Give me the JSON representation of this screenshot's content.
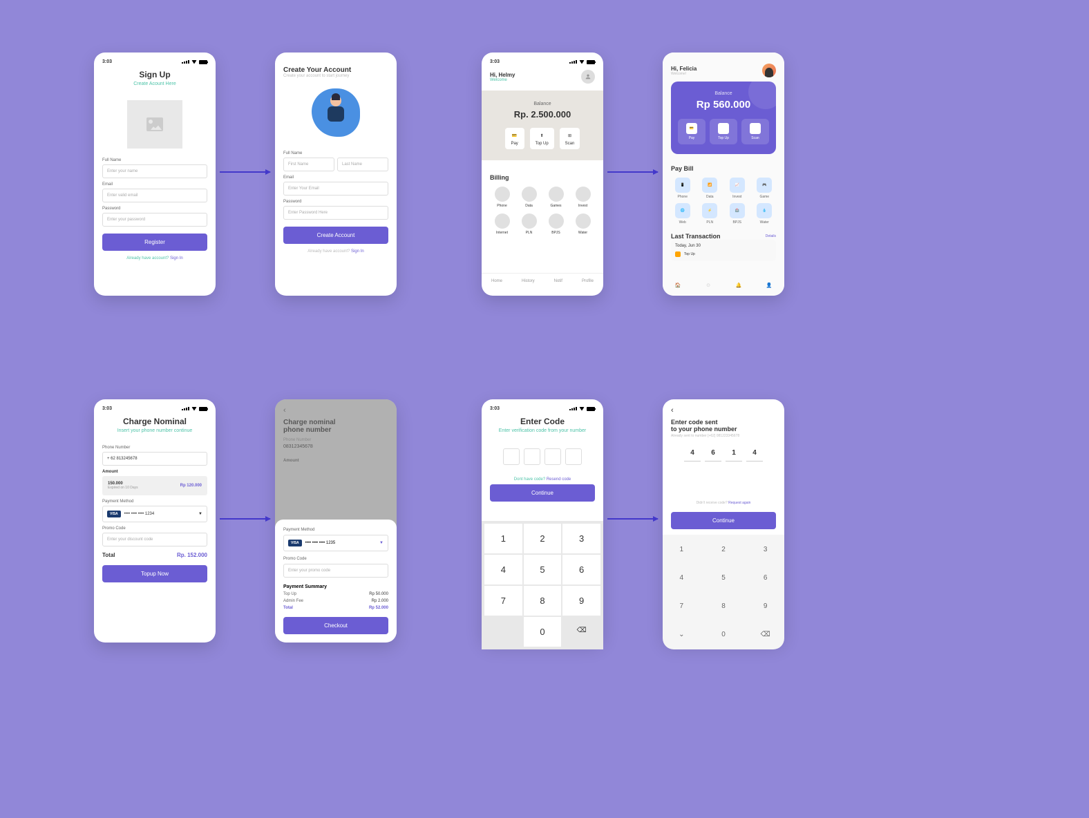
{
  "status_time": "3:03",
  "screens": {
    "signup": {
      "title": "Sign Up",
      "subtitle": "Create Acount Here",
      "full_name_label": "Full Name",
      "full_name_ph": "Enter your name",
      "email_label": "Email",
      "email_ph": "Enter valid email",
      "password_label": "Password",
      "password_ph": "Enter your password",
      "btn": "Register",
      "footer_q": "Already have account? ",
      "footer_link": "Sign In"
    },
    "create": {
      "title": "Create Your Account",
      "subtitle": "Create your account to start journey",
      "full_name_label": "Full Name",
      "first_name_ph": "First Name",
      "last_name_ph": "Last Name",
      "email_label": "Email",
      "email_ph": "Enter Your Email",
      "password_label": "Password",
      "password_ph": "Enter Password Here",
      "btn": "Create Account",
      "footer_q": "Already have account? ",
      "footer_link": "Sign In"
    },
    "home1": {
      "greeting": "Hi, Helmy",
      "welcome": "Welcome",
      "balance_label": "Balance",
      "balance": "Rp. 2.500.000",
      "actions": [
        "Pay",
        "Top Up",
        "Scan"
      ],
      "billing_title": "Billing",
      "billing1": [
        "Phone",
        "Data",
        "Games",
        "Invest"
      ],
      "billing2": [
        "Internet",
        "PLN",
        "BPJS",
        "Water"
      ],
      "nav": [
        "Home",
        "History",
        "Notif",
        "Profile"
      ]
    },
    "home2": {
      "greeting": "Hi, Felicia",
      "welcome": "Welcome!",
      "balance_label": "Balance",
      "balance": "Rp 560.000",
      "actions": [
        "Pay",
        "Top Up",
        "Scan"
      ],
      "paybill_title": "Pay Bill",
      "row1": [
        "Phone",
        "Data",
        "Invest",
        "Game"
      ],
      "row2": [
        "Web",
        "PLN",
        "BPJS",
        "Water"
      ],
      "last_trans": "Last Transaction",
      "details": "Details",
      "trans_date": "Today, Jun 30",
      "trans_item": "Top Up"
    },
    "charge": {
      "title": "Charge Nominal",
      "subtitle": "Insert your phone number continue",
      "phone_label": "Phone Number",
      "phone": "+ 62 813245678",
      "amount_label": "Amount",
      "amount_main": "150.000",
      "amount_sub": "Expired on 10 Days",
      "amount_price": "Rp 120.000",
      "payment_label": "Payment Method",
      "card_dots": "•••• •••• •••• 1234",
      "promo_label": "Promo Code",
      "promo_ph": "Enter your discount code",
      "total_label": "Total",
      "total": "Rp. 152.000",
      "btn": "Topup Now"
    },
    "checkout": {
      "bg_title": "Charge nominal\nphone number",
      "bg_phone_label": "Phone Number",
      "bg_phone": "08312345678",
      "bg_amount": "Amount",
      "payment_label": "Payment Method",
      "card_dots": "•••• •••• •••• 1235",
      "promo_label": "Promo Code",
      "promo_ph": "Enter your promo code",
      "summary_title": "Payment Summary",
      "rows": [
        {
          "l": "Top Up",
          "v": "Rp 50.000"
        },
        {
          "l": "Admin Fee",
          "v": "Rp 2.000"
        },
        {
          "l": "Total",
          "v": "Rp 52.000"
        }
      ],
      "btn": "Checkout"
    },
    "code1": {
      "title": "Enter Code",
      "subtitle": "Enter verification code from your number",
      "resend_q": "Dont have code? ",
      "resend_link": "Resend code",
      "btn": "Continue",
      "keys": [
        "1",
        "2",
        "3",
        "4",
        "5",
        "6",
        "7",
        "8",
        "9",
        "",
        "0",
        "⌫"
      ]
    },
    "code2": {
      "title1": "Enter code sent",
      "title2": "to your phone number",
      "sent_to": "Already sent to number [+62] 081223345678",
      "digits": [
        "4",
        "6",
        "1",
        "4"
      ],
      "resend_q": "Didn't receive code? ",
      "resend_link": "Request again",
      "btn": "Continue",
      "keys": [
        "1",
        "2",
        "3",
        "4",
        "5",
        "6",
        "7",
        "8",
        "9",
        "⌄",
        "0",
        "⌫"
      ]
    }
  }
}
